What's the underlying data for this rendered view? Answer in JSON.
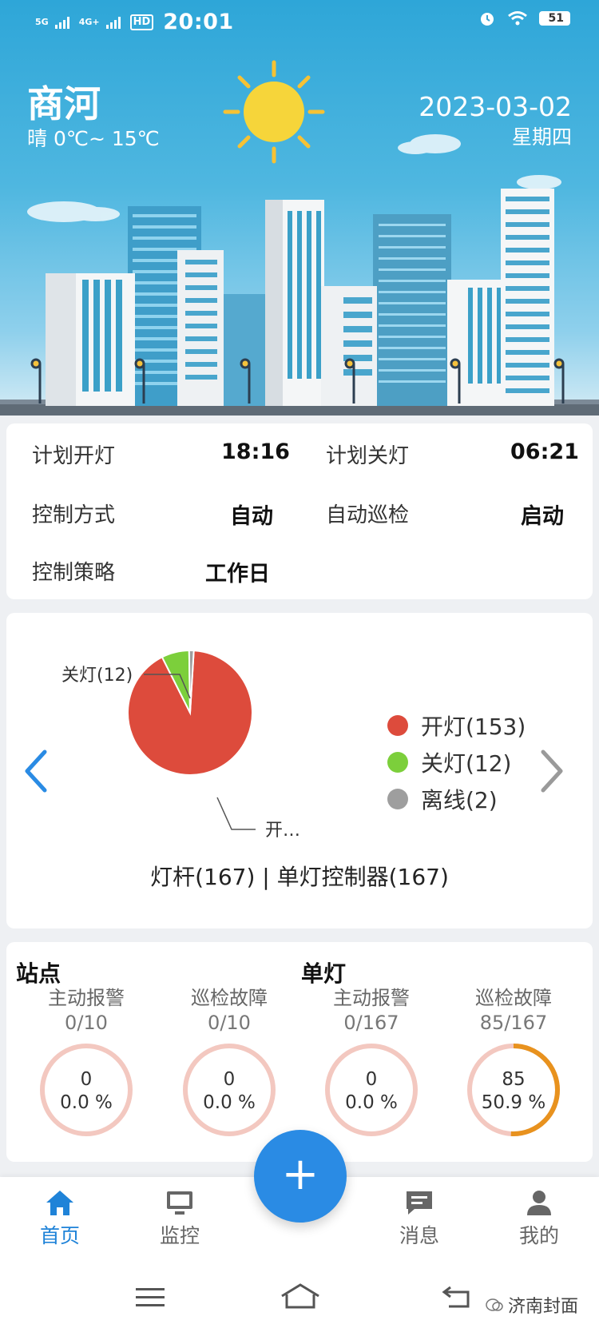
{
  "status_bar": {
    "signal1": "5G",
    "signal2": "4G+",
    "hd": "HD",
    "time": "20:01",
    "battery": "51"
  },
  "weather": {
    "city": "商河",
    "condition": "晴",
    "temp_range": "0℃~ 15℃",
    "date": "2023-03-02",
    "weekday": "星期四"
  },
  "plan": {
    "rows": [
      {
        "label": "计划开灯",
        "value": "18:16",
        "label2": "计划关灯",
        "value2": "06:21"
      },
      {
        "label": "控制方式",
        "value": "自动",
        "label2": "自动巡检",
        "value2": "启动"
      },
      {
        "label": "控制策略",
        "value": "工作日"
      }
    ]
  },
  "chart_data": {
    "type": "pie",
    "categories": [
      "开灯",
      "关灯",
      "离线"
    ],
    "values": [
      153,
      12,
      2
    ],
    "colors": [
      "#dd4b3c",
      "#7ccf3b",
      "#9e9e9e"
    ],
    "slice_labels": [
      "开…",
      "关灯(12)"
    ],
    "legend": [
      "开灯(153)",
      "关灯(12)",
      "离线(2)"
    ],
    "legend_position": "right",
    "summary": "灯杆(167) | 单灯控制器(167)"
  },
  "stats": {
    "sections": [
      "站点",
      "单灯"
    ],
    "items": [
      {
        "label": "主动报警",
        "frac": "0/10",
        "count": "0",
        "percent": "0.0 %",
        "ratio": 0
      },
      {
        "label": "巡检故障",
        "frac": "0/10",
        "count": "0",
        "percent": "0.0 %",
        "ratio": 0
      },
      {
        "label": "主动报警",
        "frac": "0/167",
        "count": "0",
        "percent": "0.0 %",
        "ratio": 0
      },
      {
        "label": "巡检故障",
        "frac": "85/167",
        "count": "85",
        "percent": "50.9 %",
        "ratio": 0.509
      }
    ],
    "ring_track_color": "#f3c8c0",
    "ring_fill_color": "#e8921e"
  },
  "nav": {
    "tabs": [
      {
        "label": "首页",
        "icon": "home-icon",
        "active": true
      },
      {
        "label": "监控",
        "icon": "monitor-icon"
      },
      {
        "label": "消息",
        "icon": "message-icon"
      },
      {
        "label": "我的",
        "icon": "user-icon"
      }
    ],
    "fab": "+",
    "accent": "#1f83d8"
  },
  "watermark": "济南封面"
}
